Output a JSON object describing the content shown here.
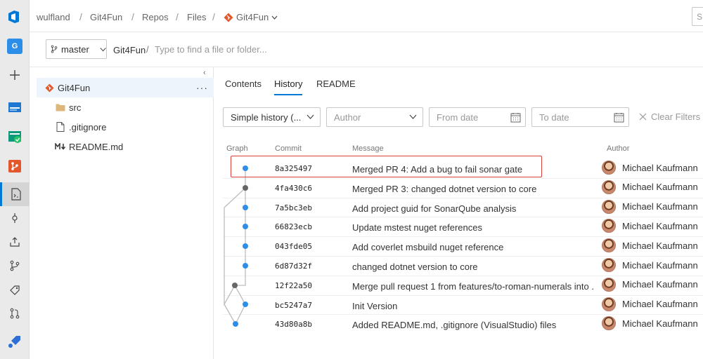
{
  "header": {
    "breadcrumbs": [
      "wulfland",
      "Git4Fun",
      "Repos",
      "Files"
    ],
    "current_repo": "Git4Fun",
    "search_placeholder": "S"
  },
  "rail": {
    "project_letter": "G"
  },
  "pathbar": {
    "branch": "master",
    "repo_root": "Git4Fun",
    "separator": "/",
    "path_placeholder": "Type to find a file or folder..."
  },
  "tree": {
    "items": [
      {
        "label": "Git4Fun",
        "icon": "repo-icon"
      },
      {
        "label": "src",
        "icon": "folder-icon"
      },
      {
        "label": ".gitignore",
        "icon": "file-icon"
      },
      {
        "label": "README.md",
        "icon": "markdown-icon"
      }
    ],
    "more_label": "···"
  },
  "tabs": [
    {
      "label": "Contents"
    },
    {
      "label": "History"
    },
    {
      "label": "README"
    }
  ],
  "filters": {
    "history_type": "Simple history (...",
    "author_placeholder": "Author",
    "from_date_placeholder": "From date",
    "to_date_placeholder": "To date",
    "clear_label": "Clear Filters"
  },
  "columns": {
    "graph": "Graph",
    "commit": "Commit",
    "message": "Message",
    "author": "Author"
  },
  "commits": [
    {
      "id": "8a325497",
      "message": "Merged PR 4: Add a bug to fail sonar gate",
      "author": "Michael Kaufmann"
    },
    {
      "id": "4fa430c6",
      "message": "Merged PR 3: changed dotnet version to core",
      "author": "Michael Kaufmann"
    },
    {
      "id": "7a5bc3eb",
      "message": "Add project guid for SonarQube analysis",
      "author": "Michael Kaufmann"
    },
    {
      "id": "66823ecb",
      "message": "Update mstest nuget references",
      "author": "Michael Kaufmann"
    },
    {
      "id": "043fde05",
      "message": "Add coverlet msbuild nuget reference",
      "author": "Michael Kaufmann"
    },
    {
      "id": "6d87d32f",
      "message": "changed dotnet version to core",
      "author": "Michael Kaufmann"
    },
    {
      "id": "12f22a50",
      "message": "Merge pull request 1 from features/to-roman-numerals into ...",
      "author": "Michael Kaufmann"
    },
    {
      "id": "bc5247a7",
      "message": "Init Version",
      "author": "Michael Kaufmann"
    },
    {
      "id": "43d80a8b",
      "message": "Added README.md, .gitignore (VisualStudio) files",
      "author": "Michael Kaufmann"
    }
  ],
  "colors": {
    "accent": "#0078d4",
    "graph_blue": "#2d8ee9",
    "graph_gray": "#666666",
    "highlight": "#d9403b"
  }
}
